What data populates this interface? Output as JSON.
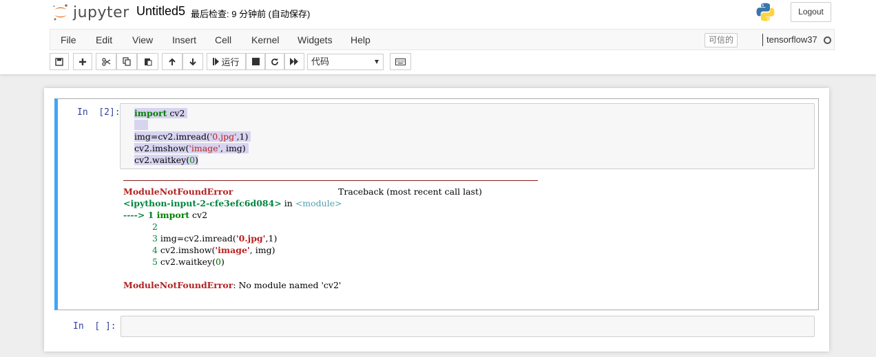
{
  "header": {
    "logo_text": "jupyter",
    "notebook_title": "Untitled5",
    "checkpoint": "最后检查: 9 分钟前   (自动保存)",
    "logout_label": "Logout"
  },
  "menubar": {
    "items": [
      "File",
      "Edit",
      "View",
      "Insert",
      "Cell",
      "Kernel",
      "Widgets",
      "Help"
    ],
    "trusted_label": "可信的",
    "kernel_name": "tensorflow37"
  },
  "toolbar": {
    "run_label": "运行",
    "cell_type": "代码"
  },
  "cell1": {
    "prompt": "In  [2]:",
    "code": {
      "l1_kw": "import",
      "l1_rest": " cv2",
      "l3_a": "img=cv2.imread(",
      "l3_str": "'0.jpg'",
      "l3_b": ",1)",
      "l4_a": "cv2.imshow(",
      "l4_str": "'image'",
      "l4_b": ", img)",
      "l5_a": "cv2.waitkey(",
      "l5_num": "0",
      "l5_b": ")"
    },
    "output": {
      "err_name": "ModuleNotFoundError",
      "traceback_label": "Traceback (most recent call last)",
      "location": "<ipython-input-2-cfe3efc6d084>",
      "in_text": " in ",
      "module_text": "<module>",
      "arrow": "---->",
      "t1_num": " 1 ",
      "t1_kw": "import",
      "t1_rest": " cv2",
      "t2_num": "2",
      "t3_num": "3",
      "t3_a": " img=cv2.imread(",
      "t3_str": "'0.jpg'",
      "t3_b": ",1)",
      "t4_num": "4",
      "t4_a": " cv2.imshow(",
      "t4_str": "'image'",
      "t4_b": ", img)",
      "t5_num": "5",
      "t5_a": " cv2.waitkey(",
      "t5_num2": "0",
      "t5_b": ")",
      "final_err": "ModuleNotFoundError",
      "final_msg": ": No module named 'cv2'"
    }
  },
  "cell2": {
    "prompt": "In  [ ]:"
  },
  "colors": {
    "selected_cell_border": "#42a5f5",
    "error_red": "#b22222",
    "prompt_blue": "#303f9f"
  },
  "icons": [
    "save-icon",
    "plus-icon",
    "cut-icon",
    "copy-icon",
    "paste-icon",
    "arrow-up-icon",
    "arrow-down-icon",
    "step-forward-icon",
    "stop-icon",
    "refresh-icon",
    "fast-forward-icon",
    "keyboard-icon",
    "python-logo-icon",
    "jupyter-logo-icon",
    "kernel-idle-icon",
    "caret-down-icon"
  ]
}
